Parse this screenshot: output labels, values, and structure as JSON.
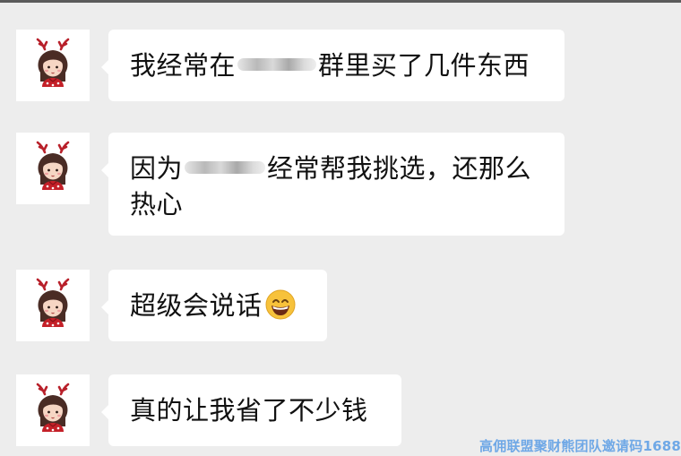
{
  "messages": [
    {
      "avatar": "reindeer-girl-avatar",
      "parts": [
        "我经常在",
        "",
        "群里买了几件东西"
      ]
    },
    {
      "avatar": "reindeer-girl-avatar",
      "parts": [
        "因为",
        "",
        "经常帮我挑选，还那么",
        "热心"
      ]
    },
    {
      "avatar": "reindeer-girl-avatar",
      "parts": [
        "超级会说话"
      ],
      "emoji": "grinning-face-emoji"
    },
    {
      "avatar": "reindeer-girl-avatar",
      "parts": [
        "真的让我省了不少钱"
      ]
    }
  ],
  "watermark": "高佣联盟聚财熊团队邀请码1688",
  "colors": {
    "background": "#ededed",
    "bubble": "#ffffff",
    "watermark": "#6fa8e6"
  }
}
